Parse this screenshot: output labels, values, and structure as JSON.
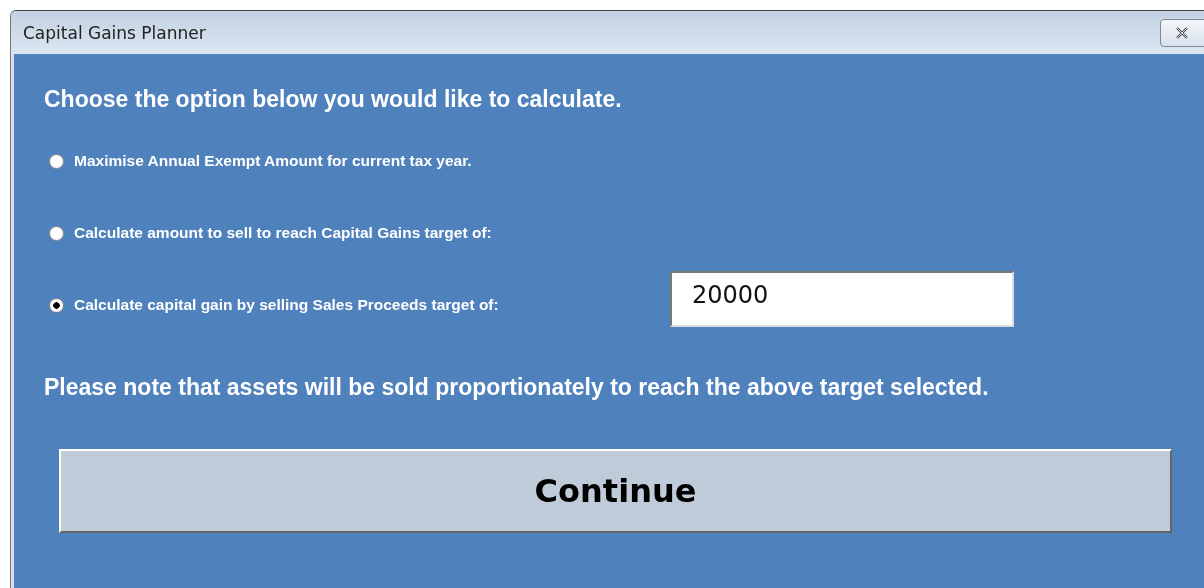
{
  "window": {
    "title": "Capital Gains Planner"
  },
  "heading": "Choose the option below you would like to calculate.",
  "options": [
    {
      "label": "Maximise Annual Exempt Amount for current tax year.",
      "selected": false
    },
    {
      "label": "Calculate amount to sell to reach Capital Gains target of:",
      "selected": false
    },
    {
      "label": "Calculate capital gain by selling Sales Proceeds target of:",
      "selected": true,
      "field": {
        "value": "20000"
      }
    }
  ],
  "note": "Please note that assets will be sold proportionately to reach the above target selected.",
  "buttons": [
    {
      "label": "Continue"
    }
  ]
}
